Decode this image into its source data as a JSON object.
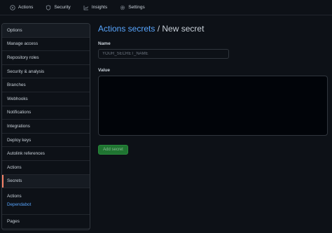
{
  "topnav": {
    "items": [
      {
        "label": "Actions",
        "icon": "play-circle-icon"
      },
      {
        "label": "Security",
        "icon": "shield-icon"
      },
      {
        "label": "Insights",
        "icon": "graph-icon"
      },
      {
        "label": "Settings",
        "icon": "gear-icon"
      }
    ]
  },
  "sidebar": {
    "items": [
      "Options",
      "Manage access",
      "Repository roles",
      "Security & analysis",
      "Branches",
      "Webhooks",
      "Notifications",
      "Integrations",
      "Deploy keys",
      "Autolink references",
      "Actions",
      "Secrets"
    ],
    "selected": "Secrets",
    "group": {
      "title": "Actions",
      "link": "Dependabot"
    },
    "last": "Pages"
  },
  "main": {
    "breadcrumb": "Actions secrets",
    "separator": " / ",
    "title": "New secret",
    "name_label": "Name",
    "name_placeholder": "YOUR_SECRET_NAME",
    "value_label": "Value",
    "add_button": "Add secret"
  },
  "colors": {
    "background": "#0d1117",
    "link": "#58a6ff",
    "button": "#238636",
    "selected_indicator": "#f78166"
  }
}
